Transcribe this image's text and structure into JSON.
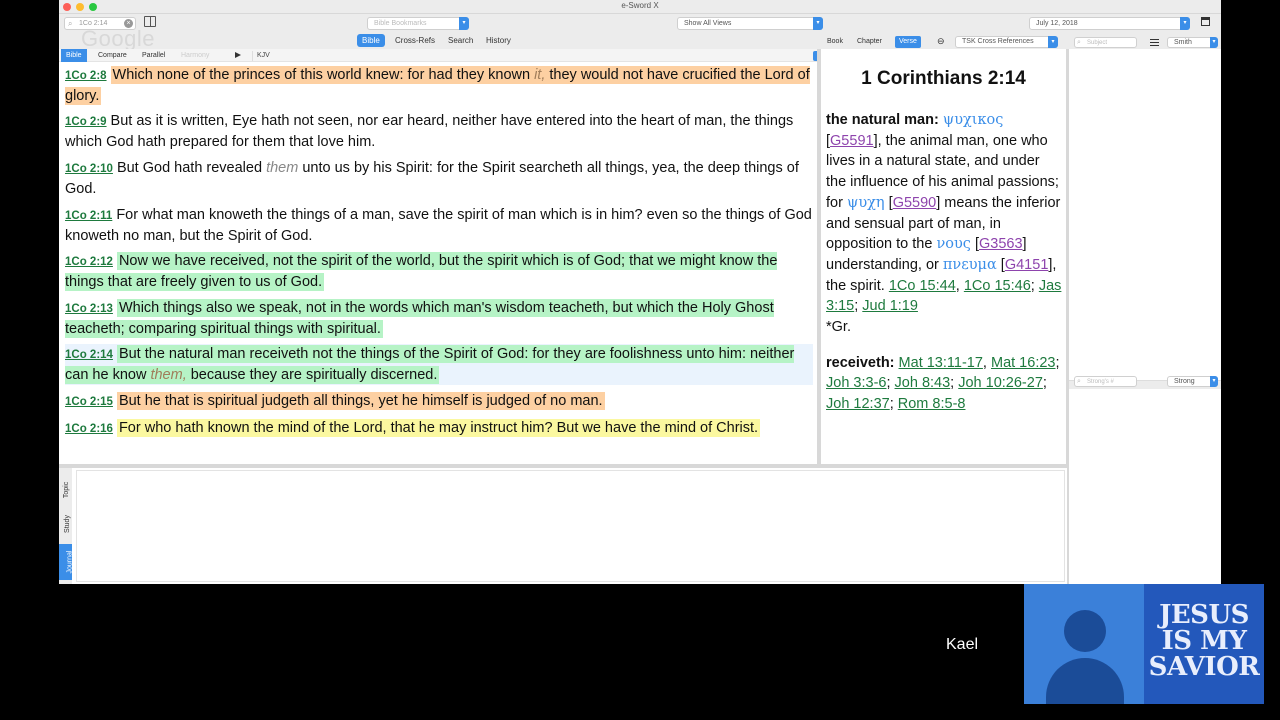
{
  "window": {
    "title": "e-Sword X"
  },
  "toolbar": {
    "search_value": "1Co 2:14",
    "google_mark": "Google",
    "bookmarks_placeholder": "Bible Bookmarks",
    "views_value": "Show All Views",
    "date_value": "July 12, 2018",
    "segments": [
      "Bible",
      "Cross-Refs",
      "Search",
      "History"
    ],
    "active_segment": "Bible"
  },
  "bible_tabs": {
    "tabs": [
      "Bible",
      "Compare",
      "Parallel",
      "Harmony"
    ],
    "version": "KJV"
  },
  "verses": [
    {
      "ref": "1Co 2:8",
      "highlight": "orange",
      "parts": [
        "Which none of the princes of this world knew: for had they known ",
        "it,",
        " they would not have crucified the Lord of glory."
      ]
    },
    {
      "ref": "1Co 2:9",
      "highlight": "none",
      "text": "But as it is written, Eye hath not seen, nor ear heard, neither have entered into the heart of man, the things which God hath prepared for them that love him."
    },
    {
      "ref": "1Co 2:10",
      "highlight": "none",
      "parts": [
        "But God hath revealed ",
        "them",
        " unto us by his Spirit: for the Spirit searcheth all things, yea, the deep things of God."
      ]
    },
    {
      "ref": "1Co 2:11",
      "highlight": "none",
      "text": "For what man knoweth the things of a man, save the spirit of man which is in him? even so the things of God knoweth no man, but the Spirit of God."
    },
    {
      "ref": "1Co 2:12",
      "highlight": "green",
      "text": "Now we have received, not the spirit of the world, but the spirit which is of God; that we might know the things that are freely given to us of God."
    },
    {
      "ref": "1Co 2:13",
      "highlight": "green",
      "text": "Which things also we speak, not in the words which man's wisdom teacheth, but which the Holy Ghost teacheth; comparing spiritual things with spiritual."
    },
    {
      "ref": "1Co 2:14",
      "highlight": "green",
      "parts": [
        "But the natural man receiveth not the things of the Spirit of God: for they are foolishness unto him: neither can he know ",
        "them,",
        " because they are spiritually discerned."
      ]
    },
    {
      "ref": "1Co 2:15",
      "highlight": "orange",
      "text": "But he that is spiritual judgeth all things, yet he himself is judged of no man."
    },
    {
      "ref": "1Co 2:16",
      "highlight": "yellow",
      "text": "For who hath known the mind of the Lord, that he may instruct him? But we have the mind of Christ."
    }
  ],
  "commentary_tabs": {
    "tabs": [
      "Book",
      "Chapter",
      "Verse"
    ],
    "active": "Verse",
    "module": "TSK Cross References"
  },
  "commentary": {
    "title": "1 Corinthians 2:14",
    "entry1": {
      "heading": "the natural man:",
      "greek1": "ψυχικος",
      "strong1": "G5591",
      "text1": ", the animal man, one who lives in a natural state, and under the influence of his animal passions; for ",
      "greek2": "ψυχη",
      "strong2": "G5590",
      "text2": " means the inferior and sensual part of man, in opposition to the ",
      "greek3": "νους",
      "strong3": "G3563",
      "text3": " understanding, or ",
      "greek4": "πνευμα",
      "strong4": "G4151",
      "text4": ", the spirit. ",
      "refs": [
        "1Co 15:44",
        "1Co 15:46",
        "Jas 3:15",
        "Jud 1:19"
      ],
      "note": "*Gr."
    },
    "entry2": {
      "heading": "receiveth:",
      "refs": [
        "Mat 13:11-17",
        "Mat 16:23",
        "Joh 3:3-6",
        "Joh 8:43",
        "Joh 10:26-27",
        "Joh 12:37",
        "Rom 8:5-8"
      ]
    }
  },
  "subject_pane": {
    "search_placeholder": "Subject",
    "dictionary_value": "Smith",
    "strong_search_placeholder": "Strong's #",
    "strong_value": "Strong"
  },
  "journal": {
    "side_tabs": [
      "Topic",
      "Study",
      "Journal"
    ],
    "active_side_tab": "Journal"
  },
  "video": {
    "participant_name": "Kael",
    "banner_lines": [
      "JESUS",
      "IS MY",
      "SAVIOR"
    ]
  },
  "colors": {
    "accent": "#3b8ee8",
    "highlight_orange": "#fdd0a2",
    "highlight_green": "#b6f3c6",
    "highlight_yellow": "#fbf8a0",
    "ref_link": "#1e7a3e",
    "strong_link": "#8e44ad"
  }
}
